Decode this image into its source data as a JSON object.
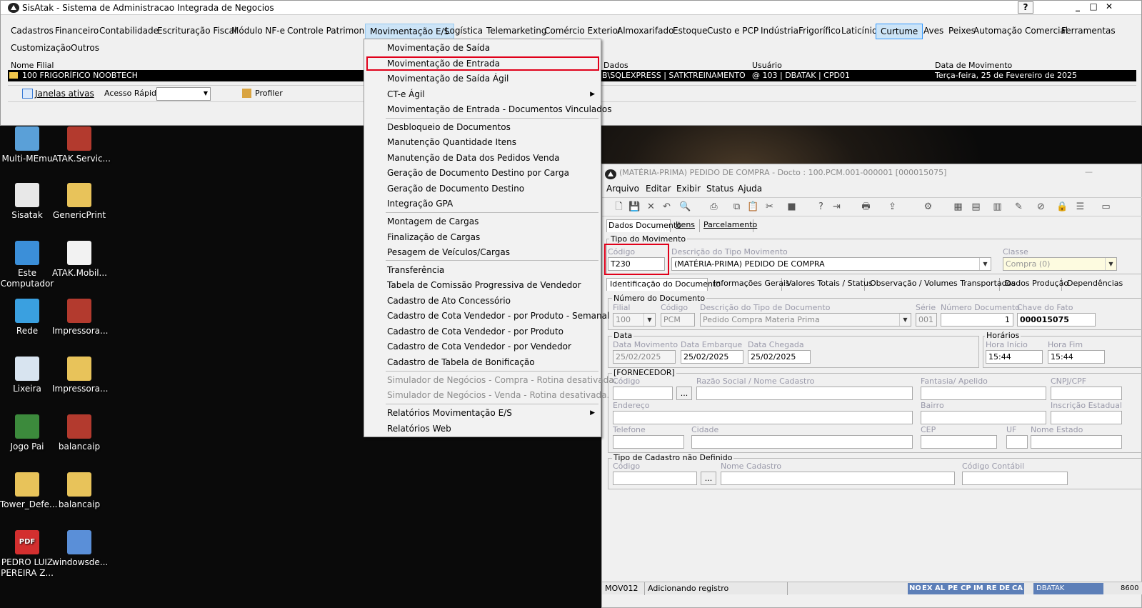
{
  "main_window": {
    "title": "SisAtak - Sistema de Administracao Integrada de Negocios",
    "help_btn": "?",
    "min_btn": "_",
    "max_btn": "□",
    "close_btn": "✕"
  },
  "menubar": [
    "Cadastros",
    "Financeiro",
    "Contabilidade",
    "Escrituração Fiscal",
    "Módulo NF-e",
    "Controle Patrimonial",
    "Movimentação E/S",
    "Logística",
    "Telemarketing",
    "Comércio Exterior",
    "Almoxarifado",
    "Estoque",
    "Custo e PCP",
    "Indústria",
    "Frigorífico",
    "Laticínio",
    "Curtume",
    "Aves",
    "Peixes",
    "Automação Comercial",
    "Ferramentas",
    "Customização",
    "Outros"
  ],
  "grid": {
    "headers": {
      "filial": "Nome Filial",
      "dados": "Dados",
      "usuario": "Usuário",
      "data": "Data de Movimento"
    },
    "row": {
      "filial": "100 FRIGORÍFICO NOOBTECH",
      "dados": "B\\SQLEXPRESS | SATKTREINAMENTO",
      "usuario": "@ 103 | DBATAK | CPD01",
      "data": "Terça-feira, 25 de Fevereiro de 2025"
    }
  },
  "toolstrip": {
    "janelas": "Janelas ativas",
    "acesso": "Acesso Rápido",
    "profiler": "Profiler"
  },
  "dropdown": {
    "items": [
      {
        "label": "Movimentação de Saída"
      },
      {
        "label": "Movimentação de Entrada"
      },
      {
        "label": "Movimentação de Saída Ágil"
      },
      {
        "label": "CT-e  Ágil",
        "sub": true
      },
      {
        "label": "Movimentação de Entrada - Documentos Vinculados"
      },
      {
        "label": "Desbloqueio de Documentos"
      },
      {
        "label": "Manutenção Quantidade Itens"
      },
      {
        "label": "Manutenção de Data dos Pedidos Venda"
      },
      {
        "label": "Geração de Documento Destino por Carga"
      },
      {
        "label": "Geração de Documento Destino"
      },
      {
        "label": "Integração GPA"
      },
      {
        "label": "Montagem de Cargas"
      },
      {
        "label": "Finalização de Cargas"
      },
      {
        "label": "Pesagem de Veículos/Cargas"
      },
      {
        "label": "Transferência"
      },
      {
        "label": "Tabela de Comissão Progressiva de Vendedor"
      },
      {
        "label": "Cadastro de Ato Concessório"
      },
      {
        "label": "Cadastro de Cota Vendedor - por Produto - Semanal"
      },
      {
        "label": "Cadastro de Cota Vendedor - por Produto"
      },
      {
        "label": "Cadastro de Cota Vendedor - por Vendedor"
      },
      {
        "label": "Cadastro de Tabela de Bonificação"
      },
      {
        "label": "Simulador de Negócios - Compra - Rotina desativada.",
        "disabled": true
      },
      {
        "label": "Simulador de Negócios - Venda - Rotina desativada.",
        "disabled": true
      },
      {
        "label": "Relatórios Movimentação E/S",
        "sub": true
      },
      {
        "label": "Relatórios Web"
      }
    ],
    "submenu_arrow": "▶"
  },
  "desktop_icons": [
    "Multi-MEmu",
    "ATAK.Servic...",
    "Sisatak",
    "GenericPrint",
    "Este Computador",
    "ATAK.Mobil...",
    "Rede",
    "Impressora...",
    "Lixeira",
    "Impressora...",
    "Jogo Pai",
    "balancaip",
    "Tower_Defe...",
    "balancaip",
    "PEDRO LUIZ PEREIRA Z...",
    "windowsde..."
  ],
  "doc": {
    "title": "(MATÉRIA-PRIMA) PEDIDO DE COMPRA - Docto : 100.PCM.001-000001 [000015075]",
    "menu": [
      "Arquivo",
      "Editar",
      "Exibir",
      "Status",
      "Ajuda"
    ],
    "tabs1": [
      "Dados Documento",
      "Itens",
      "Parcelamento"
    ],
    "tipo_mov": {
      "group": "Tipo do Movimento",
      "codigo_lbl": "Código",
      "codigo": "T230",
      "desc_lbl": "Descrição do Tipo Movimento",
      "desc": "(MATÉRIA-PRIMA) PEDIDO DE COMPRA",
      "classe_lbl": "Classe",
      "classe": "Compra (0)"
    },
    "tabs2": [
      "Identificação do Documento",
      "Informações Gerais",
      "Valores Totais / Status",
      "Observação / Volumes Transportados",
      "Dados Produção",
      "Dependências"
    ],
    "numdoc": {
      "group": "Número do Documento",
      "filial_lbl": "Filial",
      "filial": "100",
      "cod_lbl": "Código",
      "cod": "PCM",
      "desc_lbl": "Descrição do Tipo de Documento",
      "desc": "Pedido Compra Materia Prima",
      "serie_lbl": "Série",
      "serie": "001",
      "num_lbl": "Número Documento",
      "num": "1",
      "chave_lbl": "Chave do Fato",
      "chave": "000015075"
    },
    "data": {
      "group": "Data",
      "mov_lbl": "Data Movimento",
      "mov": "25/02/2025",
      "emb_lbl": "Data Embarque",
      "emb": "25/02/2025",
      "che_lbl": "Data Chegada",
      "che": "25/02/2025"
    },
    "horarios": {
      "group": "Horários",
      "ini_lbl": "Hora Início",
      "ini": "15:44",
      "fim_lbl": "Hora Fim",
      "fim": "15:44"
    },
    "fornecedor": {
      "group": "[FORNECEDOR]",
      "codigo": "Código",
      "razao": "Razão Social / Nome Cadastro",
      "fantasia": "Fantasia/ Apelido",
      "cnpj": "CNPJ/CPF",
      "endereco": "Endereço",
      "bairro": "Bairro",
      "ie": "Inscrição Estadual",
      "telefone": "Telefone",
      "cidade": "Cidade",
      "cep": "CEP",
      "uf": "UF",
      "estado": "Nome Estado",
      "ellipsis": "..."
    },
    "cadastro": {
      "group": "Tipo de Cadastro não Definido",
      "codigo": "Código",
      "nome": "Nome Cadastro",
      "contabil": "Código Contábil",
      "ellipsis": "..."
    },
    "status": {
      "code": "MOV012",
      "msg": "Adicionando registro",
      "flags": [
        "NO",
        "EX",
        "AL",
        "PE",
        "CP",
        "IM",
        "RE",
        "DE",
        "CA"
      ],
      "user": "DBATAK",
      "num": "8600"
    }
  }
}
